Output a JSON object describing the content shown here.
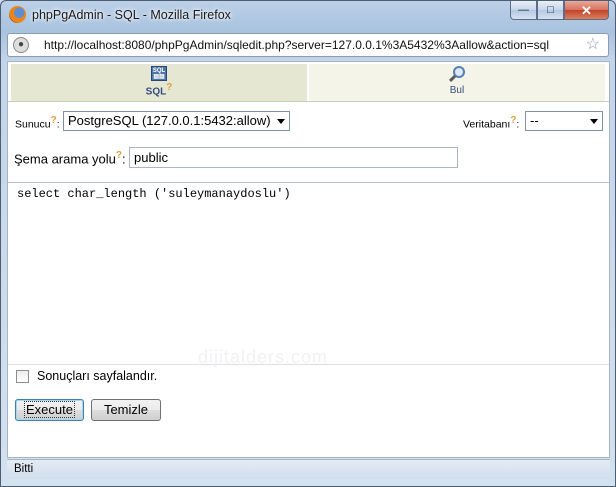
{
  "window": {
    "title": "phpPgAdmin - SQL - Mozilla Firefox",
    "minimize_glyph": "—",
    "maximize_glyph": "□",
    "close_glyph": "✕"
  },
  "addressbar": {
    "url": "http://localhost:8080/phpPgAdmin/sqledit.php?server=127.0.0.1%3A5432%3Aallow&action=sql",
    "star_glyph": "☆"
  },
  "tabs": [
    {
      "label": "SQL",
      "icon": "sql-icon",
      "help": "?"
    },
    {
      "label": "Bul",
      "icon": "magnifier-icon"
    }
  ],
  "server": {
    "label": "Sunucu",
    "help": "?",
    "selected": "PostgreSQL (127.0.0.1:5432:allow)"
  },
  "database": {
    "label": "Veritabanı",
    "help": "?",
    "selected": "--"
  },
  "schema": {
    "label": "Şema arama yolu",
    "help": "?",
    "value": "public"
  },
  "editor": {
    "query": "select char_length ('suleymanaydoslu')"
  },
  "watermark": "dijitalders.com",
  "paginate": {
    "label": "Sonuçları sayfalandır.",
    "checked": false
  },
  "buttons": {
    "execute": "Execute",
    "clear": "Temizle"
  },
  "status": {
    "text": "Bitti"
  }
}
